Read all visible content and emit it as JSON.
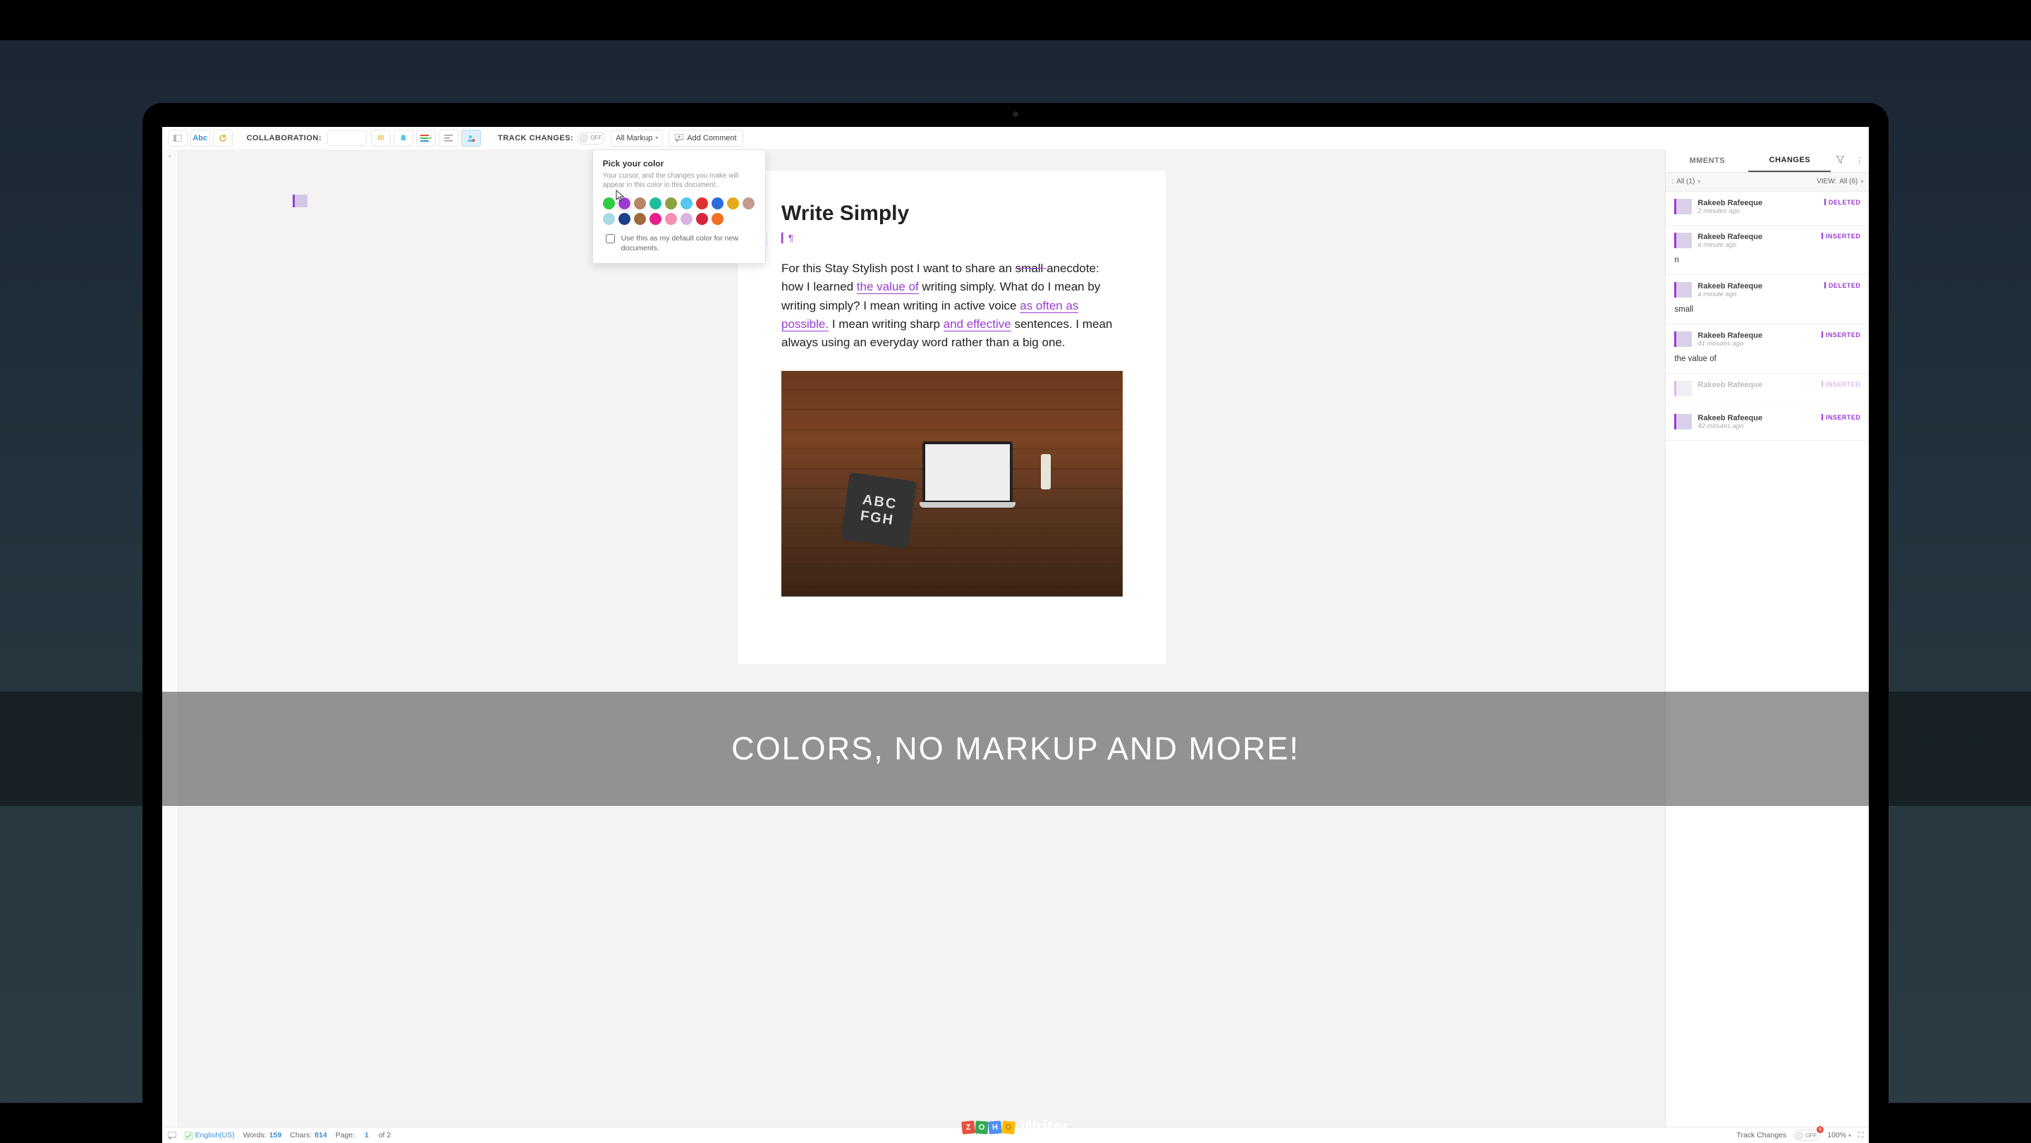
{
  "toolbar": {
    "collaboration_label": "COLLABORATION:",
    "track_changes_label": "TRACK CHANGES:",
    "track_toggle": "OFF",
    "markup_dropdown": "All Markup",
    "add_comment": "Add Comment"
  },
  "popover": {
    "title": "Pick your color",
    "description": "Your cursor, and the changes you make will appear in this color in this document.",
    "colors_row1": [
      "#2ecc40",
      "#9c3bd4",
      "#b58863",
      "#1abc9c",
      "#8aa33b",
      "#54c8f0",
      "#e03131",
      "#2d6cdf",
      "#e6a817"
    ],
    "colors_row2": [
      "#c49a8e",
      "#a6d8e7",
      "#1b3f8b",
      "#a06a3a",
      "#e91e8c",
      "#f48fb1",
      "#d9b3e0",
      "#d7263d",
      "#f36f21"
    ],
    "selected_index": 1,
    "checkbox_label": "Use this as my default color for new documents."
  },
  "document": {
    "title": "Write Simply",
    "body_parts": {
      "t1": "For this Stay Stylish post I want to share an ",
      "del1": "small ",
      "t2": "anecdote: how I learned ",
      "ins1": "the value of",
      "t3": " writing simply. What do I mean by writing simply? I mean writing in active voice ",
      "ins2": "as often as possible.",
      "t4": " I mean writing sharp ",
      "ins3": "and effective",
      "t5": " sentences. I mean always using an everyday word rather than a big one."
    }
  },
  "right_panel": {
    "tabs": {
      "comments": "MMENTS",
      "changes": "CHANGES"
    },
    "filter_user_label": ":",
    "filter_user_value": "All (1)",
    "filter_view_label": "VIEW:",
    "filter_view_value": "All (6)",
    "changes": [
      {
        "name": "Rakeeb Rafeeque",
        "time": "2 minutes ago",
        "badge": "DELETED",
        "body": ""
      },
      {
        "name": "Rakeeb Rafeeque",
        "time": "a minute ago",
        "badge": "INSERTED",
        "body": "n"
      },
      {
        "name": "Rakeeb Rafeeque",
        "time": "a minute ago",
        "badge": "DELETED",
        "body": "small"
      },
      {
        "name": "Rakeeb Rafeeque",
        "time": "41 minutes ago",
        "badge": "INSERTED",
        "body": "the value of"
      },
      {
        "name": "Rakeeb Rafeeque",
        "time": "",
        "badge": "INSERTED",
        "body": ""
      },
      {
        "name": "Rakeeb Rafeeque",
        "time": "42 minutes ago",
        "badge": "INSERTED",
        "body": ""
      }
    ]
  },
  "statusbar": {
    "language": "English(US)",
    "words_label": "Words:",
    "words": "159",
    "chars_label": "Chars:",
    "chars": "814",
    "page_label": "Page:",
    "page_current": "1",
    "page_of": "of 2",
    "track_label": "Track Changes",
    "track_toggle": "OFF",
    "track_badge": "6",
    "zoom": "100%"
  },
  "caption": "COLORS, NO MARKUP AND MORE!",
  "brand": "Writer"
}
